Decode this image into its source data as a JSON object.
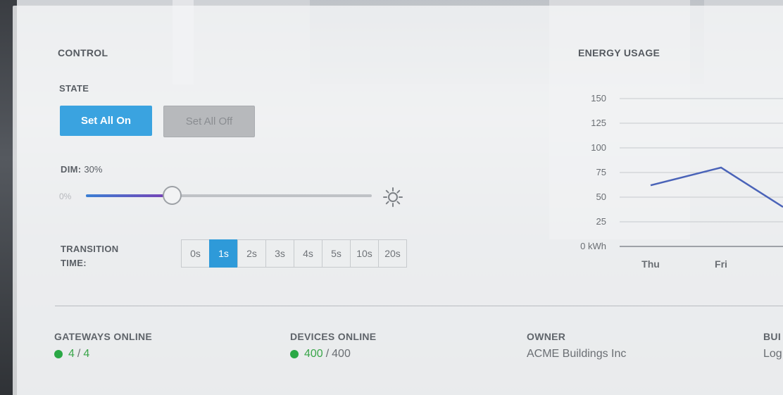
{
  "control": {
    "title": "CONTROL",
    "state_label": "STATE",
    "set_all_on": "Set All On",
    "set_all_off": "Set All Off",
    "dim_label": "DIM:",
    "dim_value": "30%",
    "dim_level_percent": 30,
    "slider_min_label": "0%",
    "transition_label_line1": "TRANSITION",
    "transition_label_line2": "TIME:",
    "transition_options": [
      "0s",
      "1s",
      "2s",
      "3s",
      "4s",
      "5s",
      "10s",
      "20s"
    ],
    "transition_selected": "1s",
    "accent_color": "#3aa3e0"
  },
  "energy": {
    "title": "ENERGY USAGE"
  },
  "chart_data": {
    "type": "line",
    "title": "ENERGY USAGE",
    "categories": [
      "Thu",
      "Fri",
      ""
    ],
    "values": [
      62,
      80,
      40
    ],
    "y_ticks": [
      "0 kWh",
      "25",
      "50",
      "75",
      "100",
      "125",
      "150"
    ],
    "ylim": [
      0,
      150
    ],
    "grid": true,
    "line_color": "#4a63b8"
  },
  "stats": {
    "gateways": {
      "label": "GATEWAYS ONLINE",
      "online": "4",
      "total": "4"
    },
    "devices": {
      "label": "DEVICES ONLINE",
      "online": "400",
      "total": "400"
    },
    "owner": {
      "label": "OWNER",
      "value": "ACME Buildings Inc"
    },
    "building": {
      "label": "BUI",
      "value": "Log"
    }
  }
}
